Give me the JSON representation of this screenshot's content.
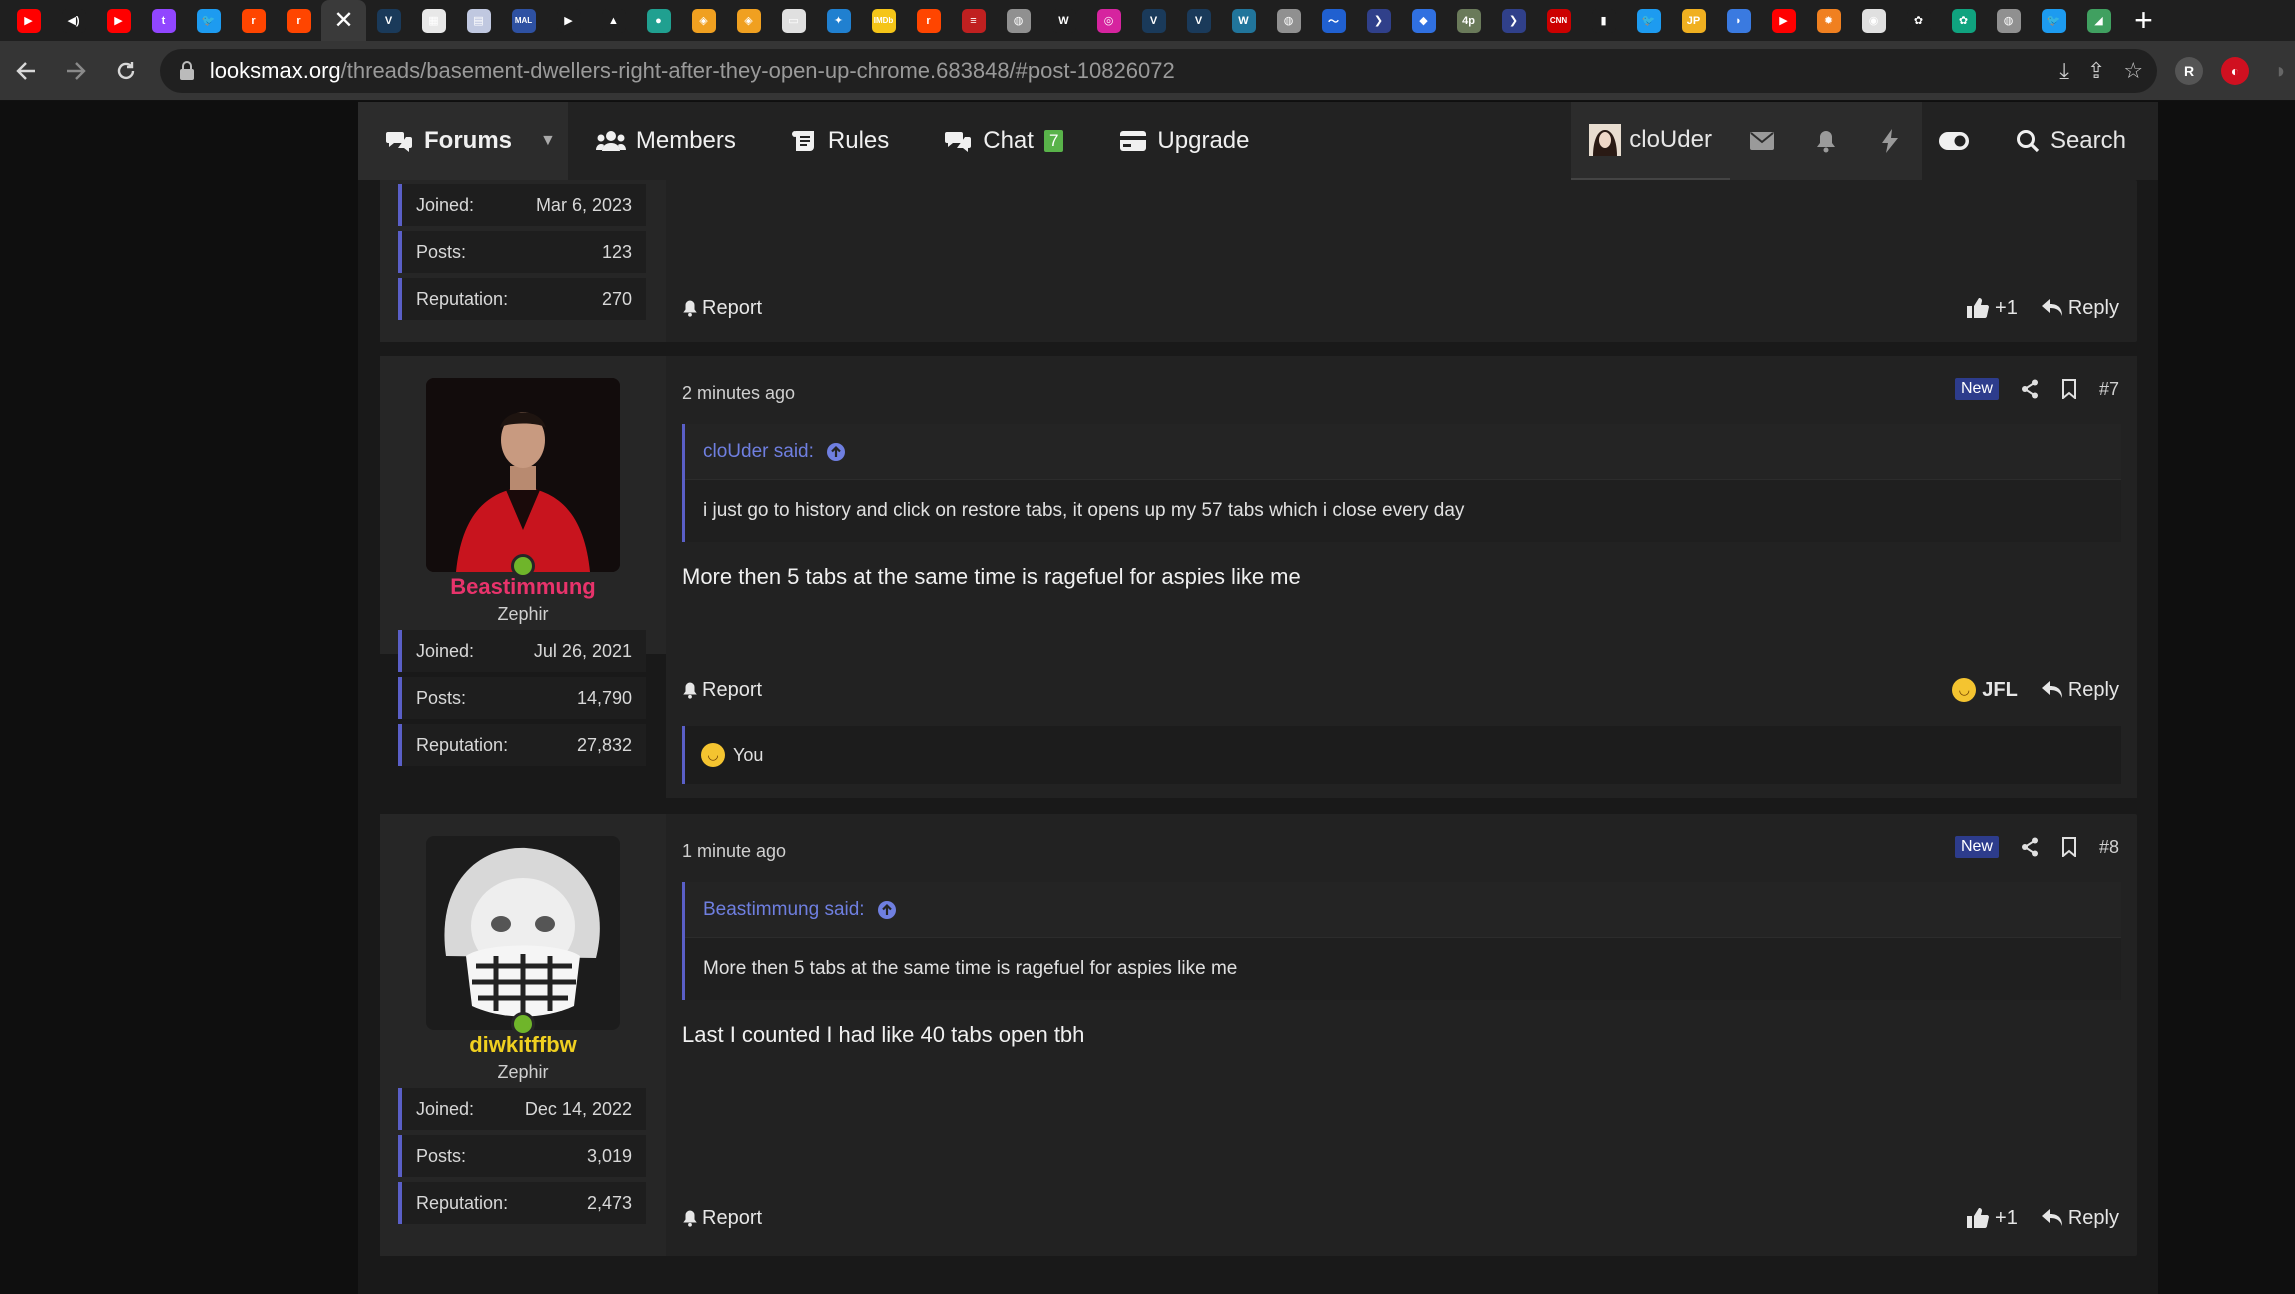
{
  "browser": {
    "url_host": "looksmax.org",
    "url_path": "/threads/basement-dwellers-right-after-they-open-up-chrome.683848/#post-10826072",
    "tabs": [
      {
        "icon": "youtube-icon",
        "color": "#ff0000",
        "glyph": "▶"
      },
      {
        "icon": "audio-icon",
        "color": "#1f1f1f",
        "glyph": "◀)"
      },
      {
        "icon": "youtube-icon",
        "color": "#ff0000",
        "glyph": "▶"
      },
      {
        "icon": "twitch-icon",
        "color": "#9146ff",
        "glyph": "t"
      },
      {
        "icon": "twitter-icon",
        "color": "#1d9bf0",
        "glyph": "🐦"
      },
      {
        "icon": "reddit-icon",
        "color": "#ff4500",
        "glyph": "r"
      },
      {
        "icon": "reddit-icon",
        "color": "#ff4500",
        "glyph": "r"
      },
      {
        "icon": "looksmax-tab",
        "color": "#3a3a3a",
        "glyph": "",
        "active": true
      },
      {
        "icon": "lm-icon",
        "color": "#1a3a5a",
        "glyph": "V"
      },
      {
        "icon": "image-icon",
        "color": "#e8e8e8",
        "glyph": "▦"
      },
      {
        "icon": "page-icon",
        "color": "#c0c8e0",
        "glyph": "▤"
      },
      {
        "icon": "mal-icon",
        "color": "#2e51a2",
        "glyph": "MAL"
      },
      {
        "icon": "play-icon",
        "color": "#1f1f1f",
        "glyph": "▶"
      },
      {
        "icon": "triangle-icon",
        "color": "#1f1f1f",
        "glyph": "▲"
      },
      {
        "icon": "globe-icon",
        "color": "#20a090",
        "glyph": "●"
      },
      {
        "icon": "box-icon",
        "color": "#f0a020",
        "glyph": "◈"
      },
      {
        "icon": "box-icon",
        "color": "#f0a020",
        "glyph": "◈"
      },
      {
        "icon": "window-icon",
        "color": "#e0e0e0",
        "glyph": "▭"
      },
      {
        "icon": "grid-icon",
        "color": "#2080d0",
        "glyph": "✦"
      },
      {
        "icon": "imdb-icon",
        "color": "#f5c518",
        "glyph": "IMDb"
      },
      {
        "icon": "reddit-icon",
        "color": "#ff4500",
        "glyph": "r"
      },
      {
        "icon": "news-icon",
        "color": "#c02020",
        "glyph": "≡"
      },
      {
        "icon": "globe-icon",
        "color": "#909090",
        "glyph": "◍"
      },
      {
        "icon": "w-icon",
        "color": "#1f1f1f",
        "glyph": "W"
      },
      {
        "icon": "instagram-icon",
        "color": "#d6249f",
        "glyph": "◎"
      },
      {
        "icon": "lm-icon",
        "color": "#1a3a5a",
        "glyph": "V"
      },
      {
        "icon": "lm-icon",
        "color": "#1a3a5a",
        "glyph": "V"
      },
      {
        "icon": "wordpress-icon",
        "color": "#21759b",
        "glyph": "W"
      },
      {
        "icon": "globe-icon",
        "color": "#909090",
        "glyph": "◍"
      },
      {
        "icon": "swoosh-icon",
        "color": "#2060d0",
        "glyph": "〜"
      },
      {
        "icon": "arrow-icon",
        "color": "#30408a",
        "glyph": "❯"
      },
      {
        "icon": "hat-icon",
        "color": "#3070e0",
        "glyph": "◆"
      },
      {
        "icon": "4p-icon",
        "color": "#6a7a5a",
        "glyph": "4p"
      },
      {
        "icon": "arrow-icon",
        "color": "#30408a",
        "glyph": "❯"
      },
      {
        "icon": "cnn-icon",
        "color": "#cc0000",
        "glyph": "CNN"
      },
      {
        "icon": "chart-icon",
        "color": "#1f1f1f",
        "glyph": "▮"
      },
      {
        "icon": "twitter-icon",
        "color": "#1d9bf0",
        "glyph": "🐦"
      },
      {
        "icon": "jp-icon",
        "color": "#f0b020",
        "glyph": "JP"
      },
      {
        "icon": "shield-icon",
        "color": "#3a7ae0",
        "glyph": "◗"
      },
      {
        "icon": "youtube-icon",
        "color": "#ff0000",
        "glyph": "▶"
      },
      {
        "icon": "sun-icon",
        "color": "#f08020",
        "glyph": "✹"
      },
      {
        "icon": "chrome-icon",
        "color": "#e0e0e0",
        "glyph": "◉"
      },
      {
        "icon": "openai-icon",
        "color": "#1f1f1f",
        "glyph": "✿"
      },
      {
        "icon": "chatgpt-icon",
        "color": "#10a37f",
        "glyph": "✿"
      },
      {
        "icon": "globe-icon",
        "color": "#909090",
        "glyph": "◍"
      },
      {
        "icon": "twitter-icon",
        "color": "#1d9bf0",
        "glyph": "🐦"
      },
      {
        "icon": "chart-icon",
        "color": "#40a060",
        "glyph": "◢"
      }
    ]
  },
  "nav": {
    "forums": "Forums",
    "members": "Members",
    "rules": "Rules",
    "chat": "Chat",
    "chat_count": "7",
    "upgrade": "Upgrade",
    "username": "cloUder",
    "search": "Search"
  },
  "prev_post": {
    "stats": [
      {
        "label": "Joined:",
        "value": "Mar 6, 2023"
      },
      {
        "label": "Posts:",
        "value": "123"
      },
      {
        "label": "Reputation:",
        "value": "270"
      }
    ],
    "report": "Report",
    "reaction": "+1",
    "reply": "Reply"
  },
  "posts": [
    {
      "username": "Beastimmung",
      "username_color": "#e8336b",
      "title": "Zephir",
      "stats": [
        {
          "label": "Joined:",
          "value": "Jul 26, 2021"
        },
        {
          "label": "Posts:",
          "value": "14,790"
        },
        {
          "label": "Reputation:",
          "value": "27,832"
        }
      ],
      "time": "2 minutes ago",
      "badge": "New",
      "number": "#7",
      "quote_author": "cloUder said:",
      "quote_text": "i just go to history and click on restore tabs, it opens up my 57 tabs which i close every day",
      "text": "More then 5 tabs at the same time is ragefuel for aspies like me",
      "report": "Report",
      "reaction": "JFL",
      "reply": "Reply",
      "reactions_summary": "You"
    },
    {
      "username": "diwkitffbw",
      "username_color": "#f0d020",
      "title": "Zephir",
      "stats": [
        {
          "label": "Joined:",
          "value": "Dec 14, 2022"
        },
        {
          "label": "Posts:",
          "value": "3,019"
        },
        {
          "label": "Reputation:",
          "value": "2,473"
        }
      ],
      "time": "1 minute ago",
      "badge": "New",
      "number": "#8",
      "quote_author": "Beastimmung said:",
      "quote_text": "More then 5 tabs at the same time is ragefuel for aspies like me",
      "text": "Last I counted I had like 40 tabs open tbh",
      "report": "Report",
      "reaction": "+1",
      "reply": "Reply"
    }
  ]
}
